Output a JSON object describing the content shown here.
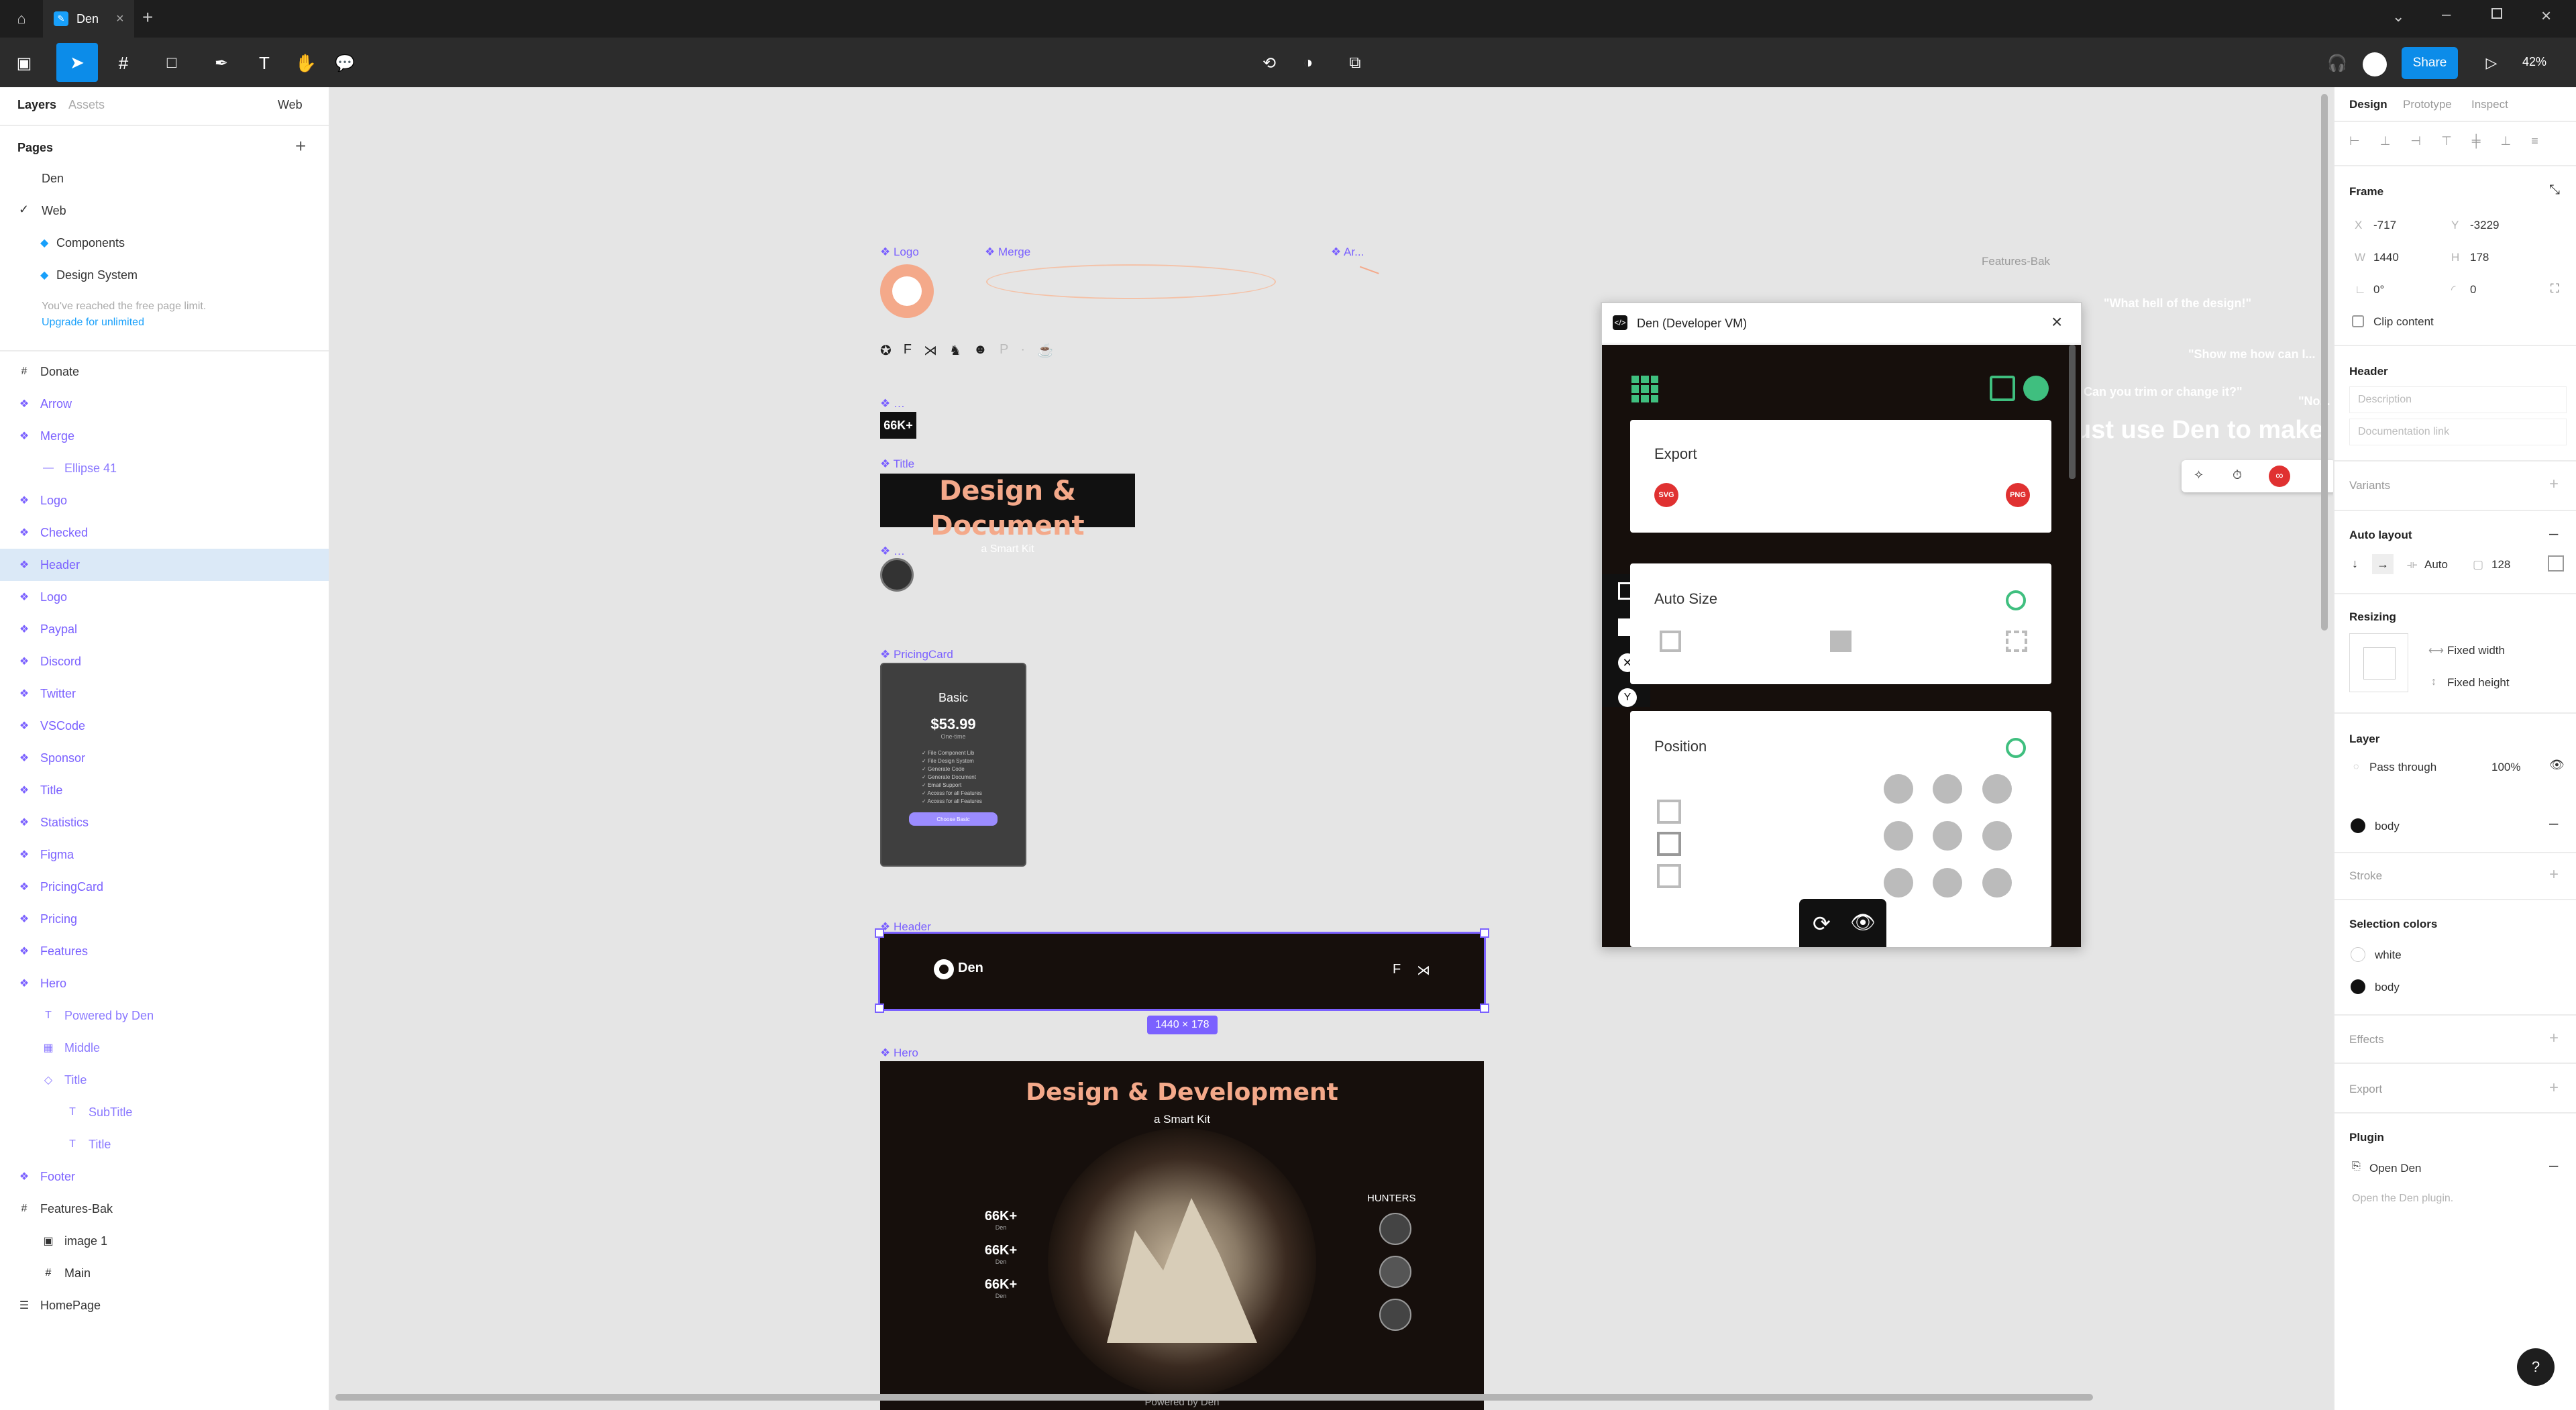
{
  "tabbar": {
    "tab_label": "Den"
  },
  "toolbar": {
    "zoom": "42%",
    "share_label": "Share"
  },
  "left": {
    "tabs": {
      "layers": "Layers",
      "assets": "Assets",
      "page_select": "Web"
    },
    "pages_title": "Pages",
    "pages": [
      "Den",
      "Web",
      "Components",
      "Design System"
    ],
    "limit_text": "You've reached the free page limit.",
    "upgrade_link": "Upgrade for unlimited",
    "layers": [
      {
        "label": "Donate",
        "kind": "frame",
        "glyph": "#",
        "indent": 0
      },
      {
        "label": "Arrow",
        "kind": "comp",
        "glyph": "❖",
        "indent": 0
      },
      {
        "label": "Merge",
        "kind": "comp",
        "glyph": "❖",
        "indent": 0
      },
      {
        "label": "Ellipse 41",
        "kind": "child",
        "glyph": "—",
        "indent": 1
      },
      {
        "label": "Logo",
        "kind": "comp",
        "glyph": "❖",
        "indent": 0
      },
      {
        "label": "Checked",
        "kind": "comp",
        "glyph": "❖",
        "indent": 0
      },
      {
        "label": "Header",
        "kind": "comp",
        "glyph": "❖",
        "indent": 0,
        "selected": true
      },
      {
        "label": "Logo",
        "kind": "comp",
        "glyph": "❖",
        "indent": 0
      },
      {
        "label": "Paypal",
        "kind": "comp",
        "glyph": "❖",
        "indent": 0
      },
      {
        "label": "Discord",
        "kind": "comp",
        "glyph": "❖",
        "indent": 0
      },
      {
        "label": "Twitter",
        "kind": "comp",
        "glyph": "❖",
        "indent": 0
      },
      {
        "label": "VSCode",
        "kind": "comp",
        "glyph": "❖",
        "indent": 0
      },
      {
        "label": "Sponsor",
        "kind": "comp",
        "glyph": "❖",
        "indent": 0
      },
      {
        "label": "Title",
        "kind": "comp",
        "glyph": "❖",
        "indent": 0
      },
      {
        "label": "Statistics",
        "kind": "comp",
        "glyph": "❖",
        "indent": 0
      },
      {
        "label": "Figma",
        "kind": "comp",
        "glyph": "❖",
        "indent": 0
      },
      {
        "label": "PricingCard",
        "kind": "comp",
        "glyph": "❖",
        "indent": 0
      },
      {
        "label": "Pricing",
        "kind": "comp",
        "glyph": "❖",
        "indent": 0
      },
      {
        "label": "Features",
        "kind": "comp",
        "glyph": "❖",
        "indent": 0
      },
      {
        "label": "Hero",
        "kind": "comp",
        "glyph": "❖",
        "indent": 0
      },
      {
        "label": "Powered by Den",
        "kind": "child",
        "glyph": "T",
        "indent": 1
      },
      {
        "label": "Middle",
        "kind": "child",
        "glyph": "▦",
        "indent": 1
      },
      {
        "label": "Title",
        "kind": "child",
        "glyph": "◇",
        "indent": 1
      },
      {
        "label": "SubTitle",
        "kind": "child",
        "glyph": "T",
        "indent": 2
      },
      {
        "label": "Title",
        "kind": "child",
        "glyph": "T",
        "indent": 2
      },
      {
        "label": "Footer",
        "kind": "comp",
        "glyph": "❖",
        "indent": 0
      },
      {
        "label": "Features-Bak",
        "kind": "frame",
        "glyph": "#",
        "indent": 0
      },
      {
        "label": "image 1",
        "kind": "frameChild",
        "glyph": "▣",
        "indent": 1
      },
      {
        "label": "Main",
        "kind": "frameChild",
        "glyph": "#",
        "indent": 1
      },
      {
        "label": "HomePage",
        "kind": "frame",
        "glyph": "☰",
        "indent": 0
      }
    ]
  },
  "right": {
    "tabs": {
      "design": "Design",
      "prototype": "Prototype",
      "inspect": "Inspect"
    },
    "frame_label": "Frame",
    "x_label": "X",
    "x": "-717",
    "y_label": "Y",
    "y": "-3229",
    "w_label": "W",
    "w": "1440",
    "h_label": "H",
    "h": "178",
    "rotation": "0°",
    "radius": "0",
    "clip": "Clip content",
    "header_section": "Header",
    "desc_placeholder": "Description",
    "doc_placeholder": "Documentation link",
    "variants": "Variants",
    "auto_layout": "Auto layout",
    "al_spacing": "Auto",
    "al_padding": "128",
    "resizing": "Resizing",
    "fixed_width": "Fixed width",
    "fixed_height": "Fixed height",
    "layer": "Layer",
    "pass_through": "Pass through",
    "opacity": "100%",
    "fill_name": "body",
    "stroke": "Stroke",
    "selection_colors": "Selection colors",
    "sel_white": "white",
    "sel_body": "body",
    "effects": "Effects",
    "export": "Export",
    "plugin": "Plugin",
    "open_den": "Open Den",
    "plugin_hint": "Open the Den plugin."
  },
  "canvas": {
    "labels": {
      "logo": "Logo",
      "merge": "Merge",
      "arrow": "Ar...",
      "features_bak": "Features-Bak",
      "title": "Title",
      "pricing": "PricingCard",
      "header": "Header",
      "hero": "Hero"
    },
    "stat_small": "66K+",
    "title_text": "Design & Document",
    "title_sub": "a Smart Kit",
    "pricing": {
      "plan": "Basic",
      "price": "$53.99",
      "period": "One-time",
      "features": [
        "File Component Lib",
        "File Design System",
        "Generate Code",
        "Generate Document",
        "Email Support",
        "Access for all Features",
        "Access for all Features"
      ],
      "cta": "Choose Basic"
    },
    "header_logo": "Den",
    "size_badge": "1440 × 178",
    "hero": {
      "title": "Design & Development",
      "subtitle": "a Smart Kit",
      "stats": [
        "66K+",
        "66K+",
        "66K+"
      ],
      "stat_caption": "Den",
      "hunters": "HUNTERS",
      "powered": "Powered by Den"
    },
    "quotes": [
      "\"What hell of the design!\"",
      "\"Show me how can I...",
      "Can you trim or change it?\"",
      "\"No...",
      "ust use Den to make"
    ]
  },
  "plugin": {
    "title": "Den (Developer VM)",
    "export_title": "Export",
    "svg": "SVG",
    "png": "PNG",
    "autosize_title": "Auto Size",
    "position_title": "Position"
  }
}
